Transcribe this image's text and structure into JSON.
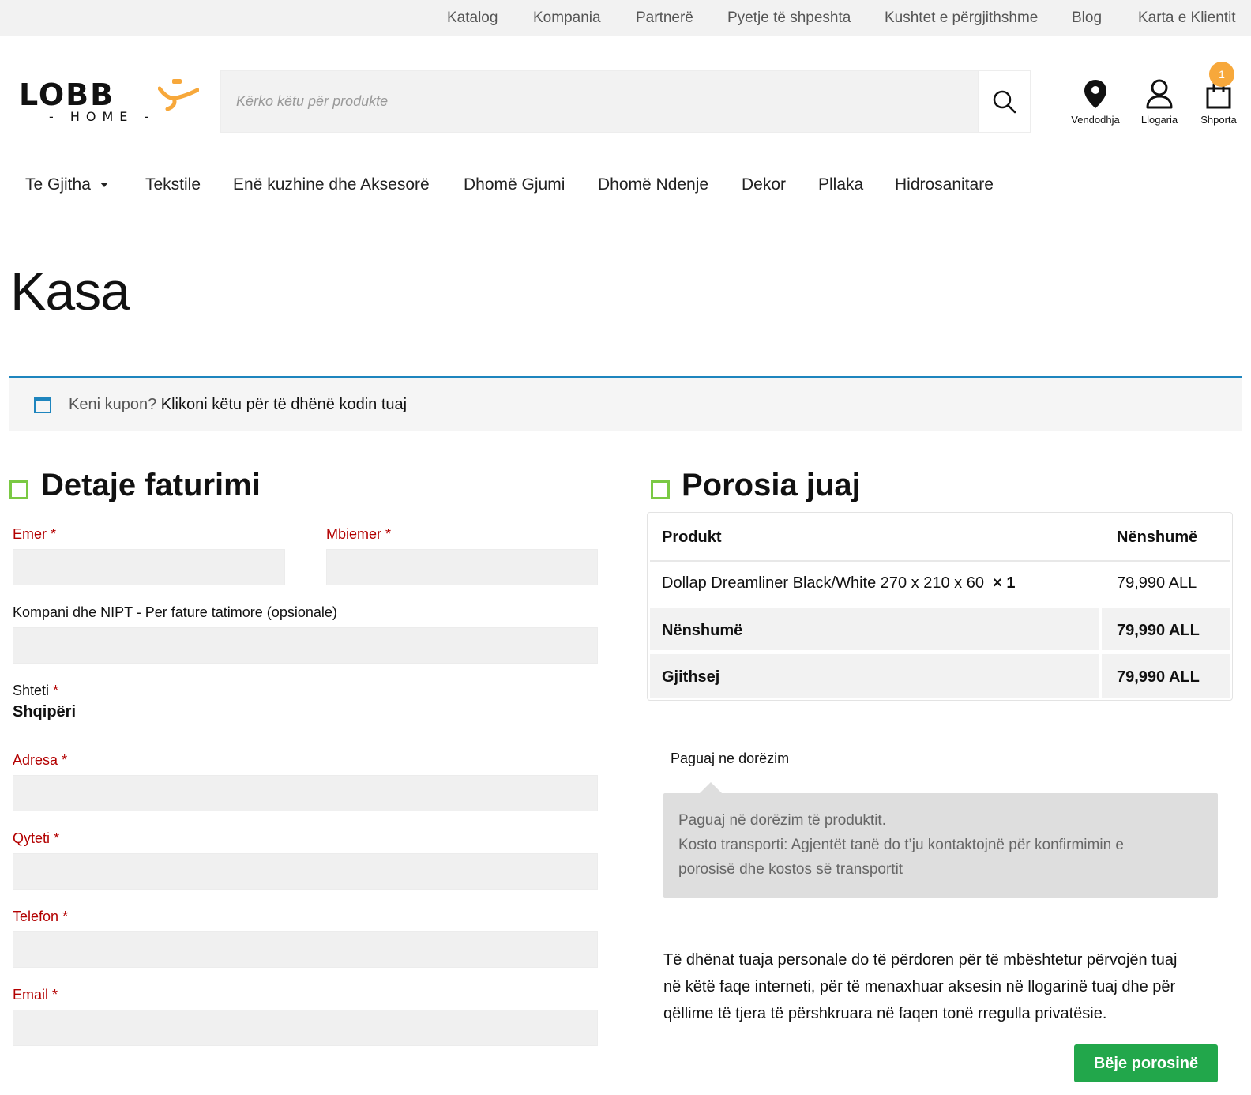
{
  "topbar": {
    "links": [
      "Katalog",
      "Kompania",
      "Partnerë",
      "Pyetje të shpeshta",
      "Kushtet e përgjithshme",
      "Blog",
      "Karta e Klientit"
    ]
  },
  "logo": {
    "word": "LOBB",
    "sub": "- HOME -",
    "accent": "#f7a83b"
  },
  "search": {
    "placeholder": "Kërko këtu për produkte",
    "icon": "search-icon"
  },
  "header_icons": {
    "location": {
      "label": "Vendodhja",
      "icon": "location-pin-icon"
    },
    "account": {
      "label": "Llogaria",
      "icon": "user-icon"
    },
    "cart": {
      "label": "Shporta",
      "icon": "shopping-bag-icon",
      "count": "1"
    }
  },
  "mainnav": {
    "items": [
      "Te Gjitha",
      "Tekstile",
      "Enë kuzhine dhe Aksesorë",
      "Dhomë Gjumi",
      "Dhomë Ndenje",
      "Dekor",
      "Pllaka",
      "Hidrosanitare"
    ]
  },
  "page": {
    "title": "Kasa"
  },
  "coupon": {
    "question": "Keni kupon?",
    "link": "Klikoni këtu për të dhënë kodin tuaj",
    "accent": "#1e85be"
  },
  "billing": {
    "heading": "Detaje faturimi",
    "first_name": "Emer",
    "last_name": "Mbiemer",
    "company": "Kompani dhe NIPT - Per fature tatimore (opsionale)",
    "country_label": "Shteti",
    "country_value": "Shqipëri",
    "address": "Adresa",
    "city": "Qyteti",
    "phone": "Telefon",
    "email": "Email",
    "required_mark": "*"
  },
  "order": {
    "heading": "Porosia juaj",
    "col_product": "Produkt",
    "col_subtotal": "Nënshumë",
    "item_name": "Dollap Dreamliner Black/White 270 x 210 x 60",
    "item_qty": "× 1",
    "item_price": "79,990 ALL",
    "subtotal_label": "Nënshumë",
    "subtotal_value": "79,990 ALL",
    "total_label": "Gjithsej",
    "total_value": "79,990 ALL"
  },
  "payment": {
    "method": "Paguaj ne dorëzim",
    "desc_line1": "Paguaj në dorëzim të produktit.",
    "desc_line2": "Kosto transporti: Agjentët tanë do t’ju kontaktojnë për konfirmimin e",
    "desc_line3": "porosisë dhe kostos së transportit"
  },
  "privacy": {
    "line1": "Të dhënat tuaja personale do të përdoren për të mbështetur përvojën tuaj",
    "line2": "në këtë faqe interneti, për të menaxhuar aksesin në llogarinë tuaj dhe për",
    "line3": "qëllime të tjera të përshkruara në faqen tonë rregulla privatësie."
  },
  "place_order": {
    "label": "Bëje porosinë",
    "color": "#22a74b"
  },
  "colors": {
    "required": "#b30000",
    "section_square": "#7ac943"
  }
}
